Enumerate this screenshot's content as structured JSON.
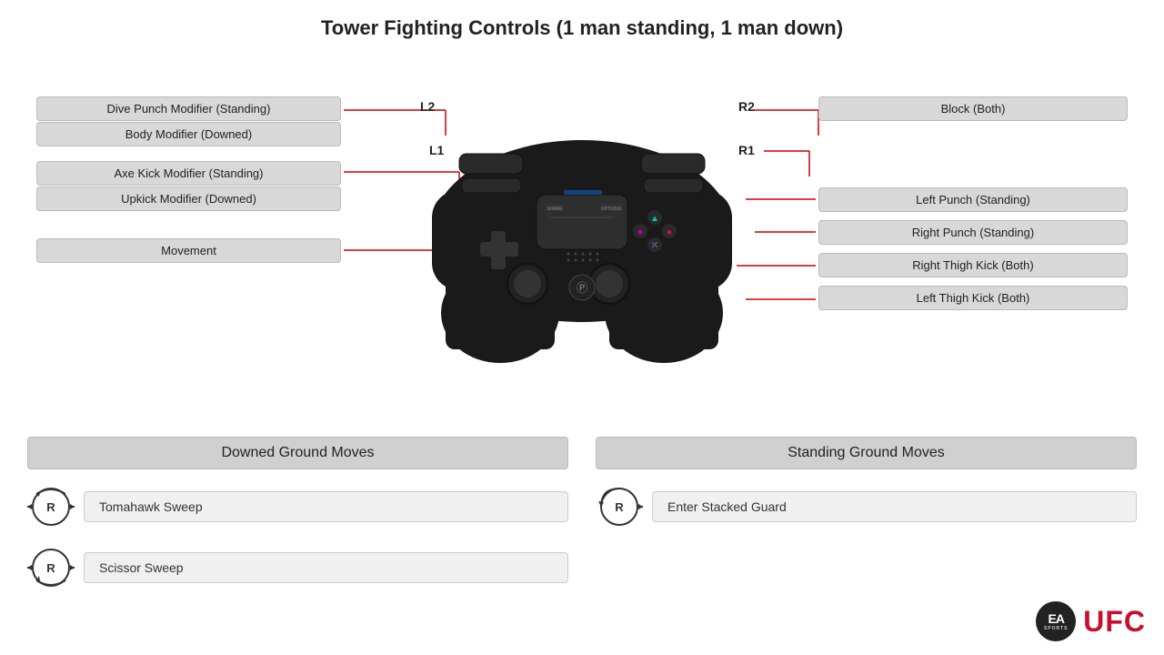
{
  "title": "Tower Fighting Controls (1 man standing, 1 man down)",
  "left_labels": {
    "l2_top": "Dive Punch Modifier (Standing)",
    "l2_bottom": "Body Modifier (Downed)",
    "l1_top": "Axe Kick Modifier (Standing)",
    "l1_bottom": "Upkick Modifier (Downed)",
    "movement": "Movement",
    "l2_tag": "L2",
    "l1_tag": "L1"
  },
  "right_labels": {
    "r2_tag": "R2",
    "r1_tag": "R1",
    "r2_label": "Block (Both)",
    "triangle": "Left Punch (Standing)",
    "circle": "Right Punch (Standing)",
    "square": "Right Thigh Kick (Both)",
    "cross": "Left Thigh Kick (Both)"
  },
  "bottom": {
    "downed_title": "Downed Ground Moves",
    "standing_title": "Standing Ground Moves",
    "move1_label": "Tomahawk Sweep",
    "move2_label": "Scissor Sweep",
    "move3_label": "Enter Stacked Guard"
  },
  "branding": {
    "ea": "EA",
    "sports": "SPORTS",
    "ufc": "UFC"
  }
}
